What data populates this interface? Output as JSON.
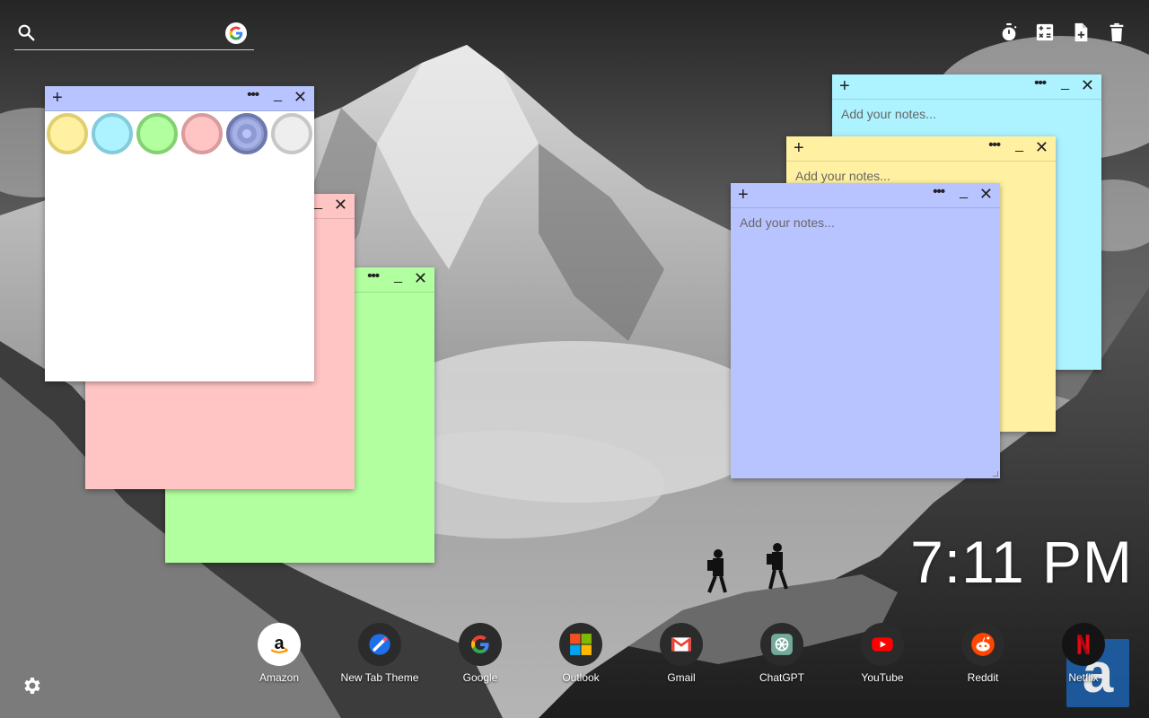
{
  "search": {
    "placeholder": "",
    "icon": "search-icon",
    "engine_icon": "google-icon"
  },
  "toolbar": [
    {
      "name": "timer",
      "icon": "timer-icon"
    },
    {
      "name": "calculator",
      "icon": "calculator-icon"
    },
    {
      "name": "new-note",
      "icon": "add-note-icon"
    },
    {
      "name": "delete",
      "icon": "trash-icon"
    }
  ],
  "notes": {
    "white": {
      "color": "#ffffff",
      "placeholder": ""
    },
    "pink": {
      "color": "#ffc4c4",
      "placeholder": ""
    },
    "green": {
      "color": "#b1ff9e",
      "placeholder": ""
    },
    "cyan": {
      "color": "#acf2ff",
      "placeholder": "Add your notes..."
    },
    "yellow": {
      "color": "#fff1a1",
      "placeholder": "Add your notes..."
    },
    "blue": {
      "color": "#b8c4ff",
      "placeholder": "Add your notes..."
    },
    "add_glyph": "+",
    "menu_glyph": "•••",
    "min_glyph": "_",
    "close_glyph": "✕"
  },
  "swatches": [
    {
      "name": "yellow",
      "color": "#fff1a1",
      "border": "#e1cf6e"
    },
    {
      "name": "cyan",
      "color": "#acf2ff",
      "border": "#84cbdb"
    },
    {
      "name": "green",
      "color": "#b1ff9e",
      "border": "#83d171"
    },
    {
      "name": "pink",
      "color": "#ffc4c4",
      "border": "#d99b9b"
    },
    {
      "name": "blue",
      "color": "#8e9ad1",
      "border": "#6d78ad",
      "selected": true
    },
    {
      "name": "gray",
      "color": "#eeeeee",
      "border": "#c7c7c7"
    }
  ],
  "clock": {
    "time": "7:11 PM"
  },
  "shortcuts": [
    {
      "label": "Amazon",
      "icon": "amazon-icon"
    },
    {
      "label": "New Tab Theme",
      "icon": "new-tab-theme-icon"
    },
    {
      "label": "Google",
      "icon": "google-icon"
    },
    {
      "label": "Outlook",
      "icon": "microsoft-icon"
    },
    {
      "label": "Gmail",
      "icon": "gmail-icon"
    },
    {
      "label": "ChatGPT",
      "icon": "chatgpt-icon"
    },
    {
      "label": "YouTube",
      "icon": "youtube-icon"
    },
    {
      "label": "Reddit",
      "icon": "reddit-icon"
    },
    {
      "label": "Netflix",
      "icon": "netflix-icon"
    }
  ],
  "badge": {
    "letter": "a"
  }
}
